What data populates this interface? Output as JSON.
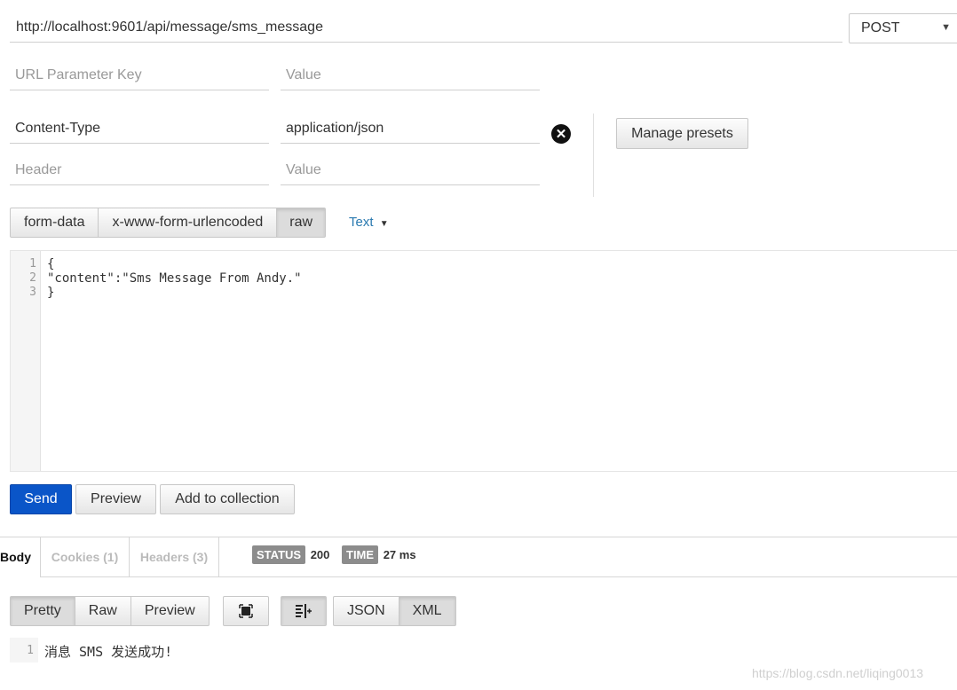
{
  "request": {
    "url": "http://localhost:9601/api/message/sms_message",
    "method": "POST",
    "url_param_key_placeholder": "URL Parameter Key",
    "url_param_value_placeholder": "Value",
    "headers": [
      {
        "key": "Content-Type",
        "value": "application/json"
      }
    ],
    "header_key_placeholder": "Header",
    "header_value_placeholder": "Value",
    "manage_presets_label": "Manage presets",
    "body_tabs": [
      "form-data",
      "x-www-form-urlencoded",
      "raw"
    ],
    "body_type": "Text",
    "editor_lines": [
      {
        "n": "1",
        "text": "{"
      },
      {
        "n": "2",
        "text": "\"content\":\"Sms Message From Andy.\""
      },
      {
        "n": "3",
        "text": "}"
      }
    ],
    "send_label": "Send",
    "preview_label": "Preview",
    "add_collection_label": "Add to collection"
  },
  "response": {
    "tabs": {
      "body": "Body",
      "cookies": "Cookies (1)",
      "headers": "Headers (3)"
    },
    "status_label": "STATUS",
    "status_value": "200",
    "time_label": "TIME",
    "time_value": "27 ms",
    "view_tabs": [
      "Pretty",
      "Raw",
      "Preview"
    ],
    "format_tabs": [
      "JSON",
      "XML"
    ],
    "body_lines": [
      {
        "n": "1",
        "text": "消息 SMS 发送成功!"
      }
    ]
  },
  "watermark": "https://blog.csdn.net/liqing0013",
  "colors": {
    "send_bg": "#0a55c8",
    "tab_link": "#2a7ab0",
    "badge_bg": "#8c8c8c"
  }
}
